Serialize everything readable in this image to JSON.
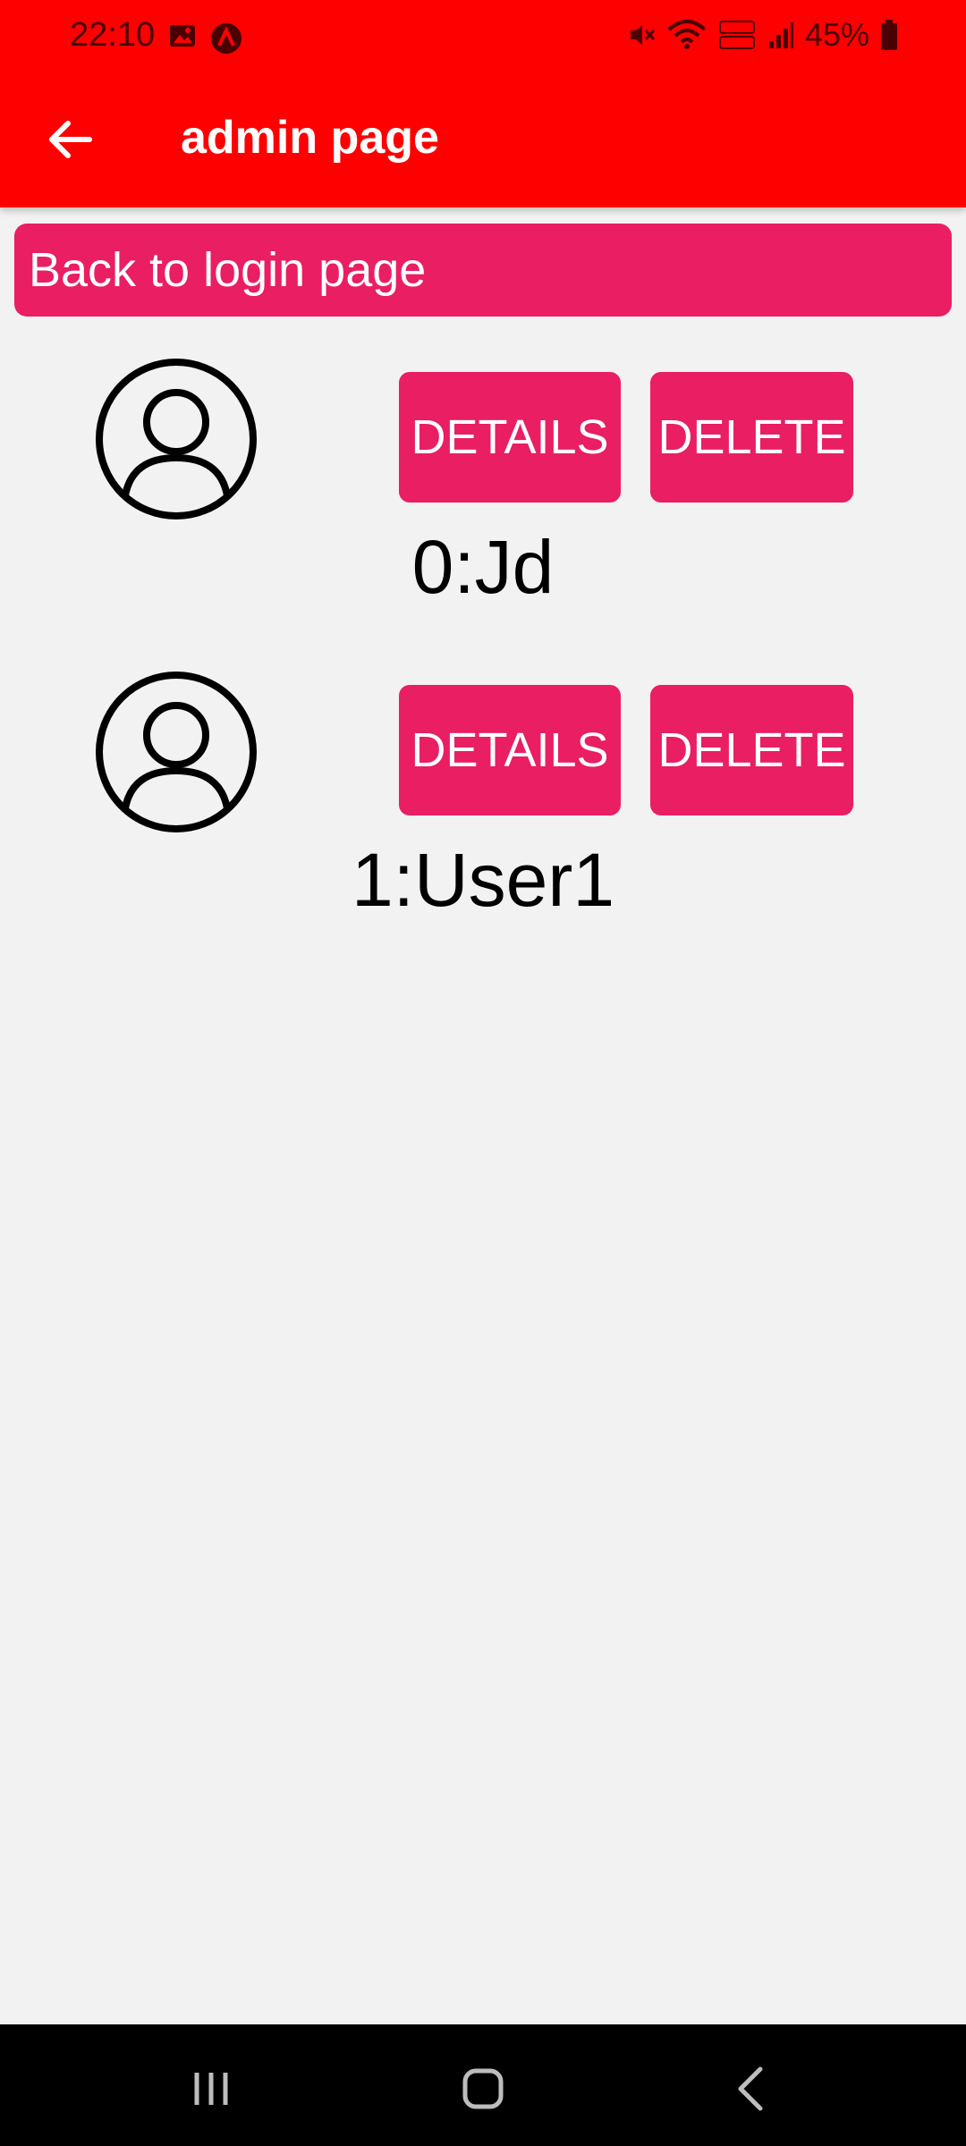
{
  "status_bar": {
    "time": "22:10",
    "battery": "45%"
  },
  "app_bar": {
    "title": "admin page"
  },
  "back_to_login": {
    "label": "Back to login page"
  },
  "users": [
    {
      "name": "0:Jd",
      "details_label": "DETAILS",
      "delete_label": "DELETE"
    },
    {
      "name": "1:User1",
      "details_label": "DETAILS",
      "delete_label": "DELETE"
    }
  ],
  "colors": {
    "app_bar": "#ff0000",
    "accent_button": "#e91e63",
    "background": "#f2f2f2",
    "nav_bar": "#000000"
  },
  "icons": {
    "back": "arrow-left-icon",
    "avatar": "user-avatar-icon",
    "nav_recents": "recents-icon",
    "nav_home": "home-icon",
    "nav_back": "back-chevron-icon"
  }
}
